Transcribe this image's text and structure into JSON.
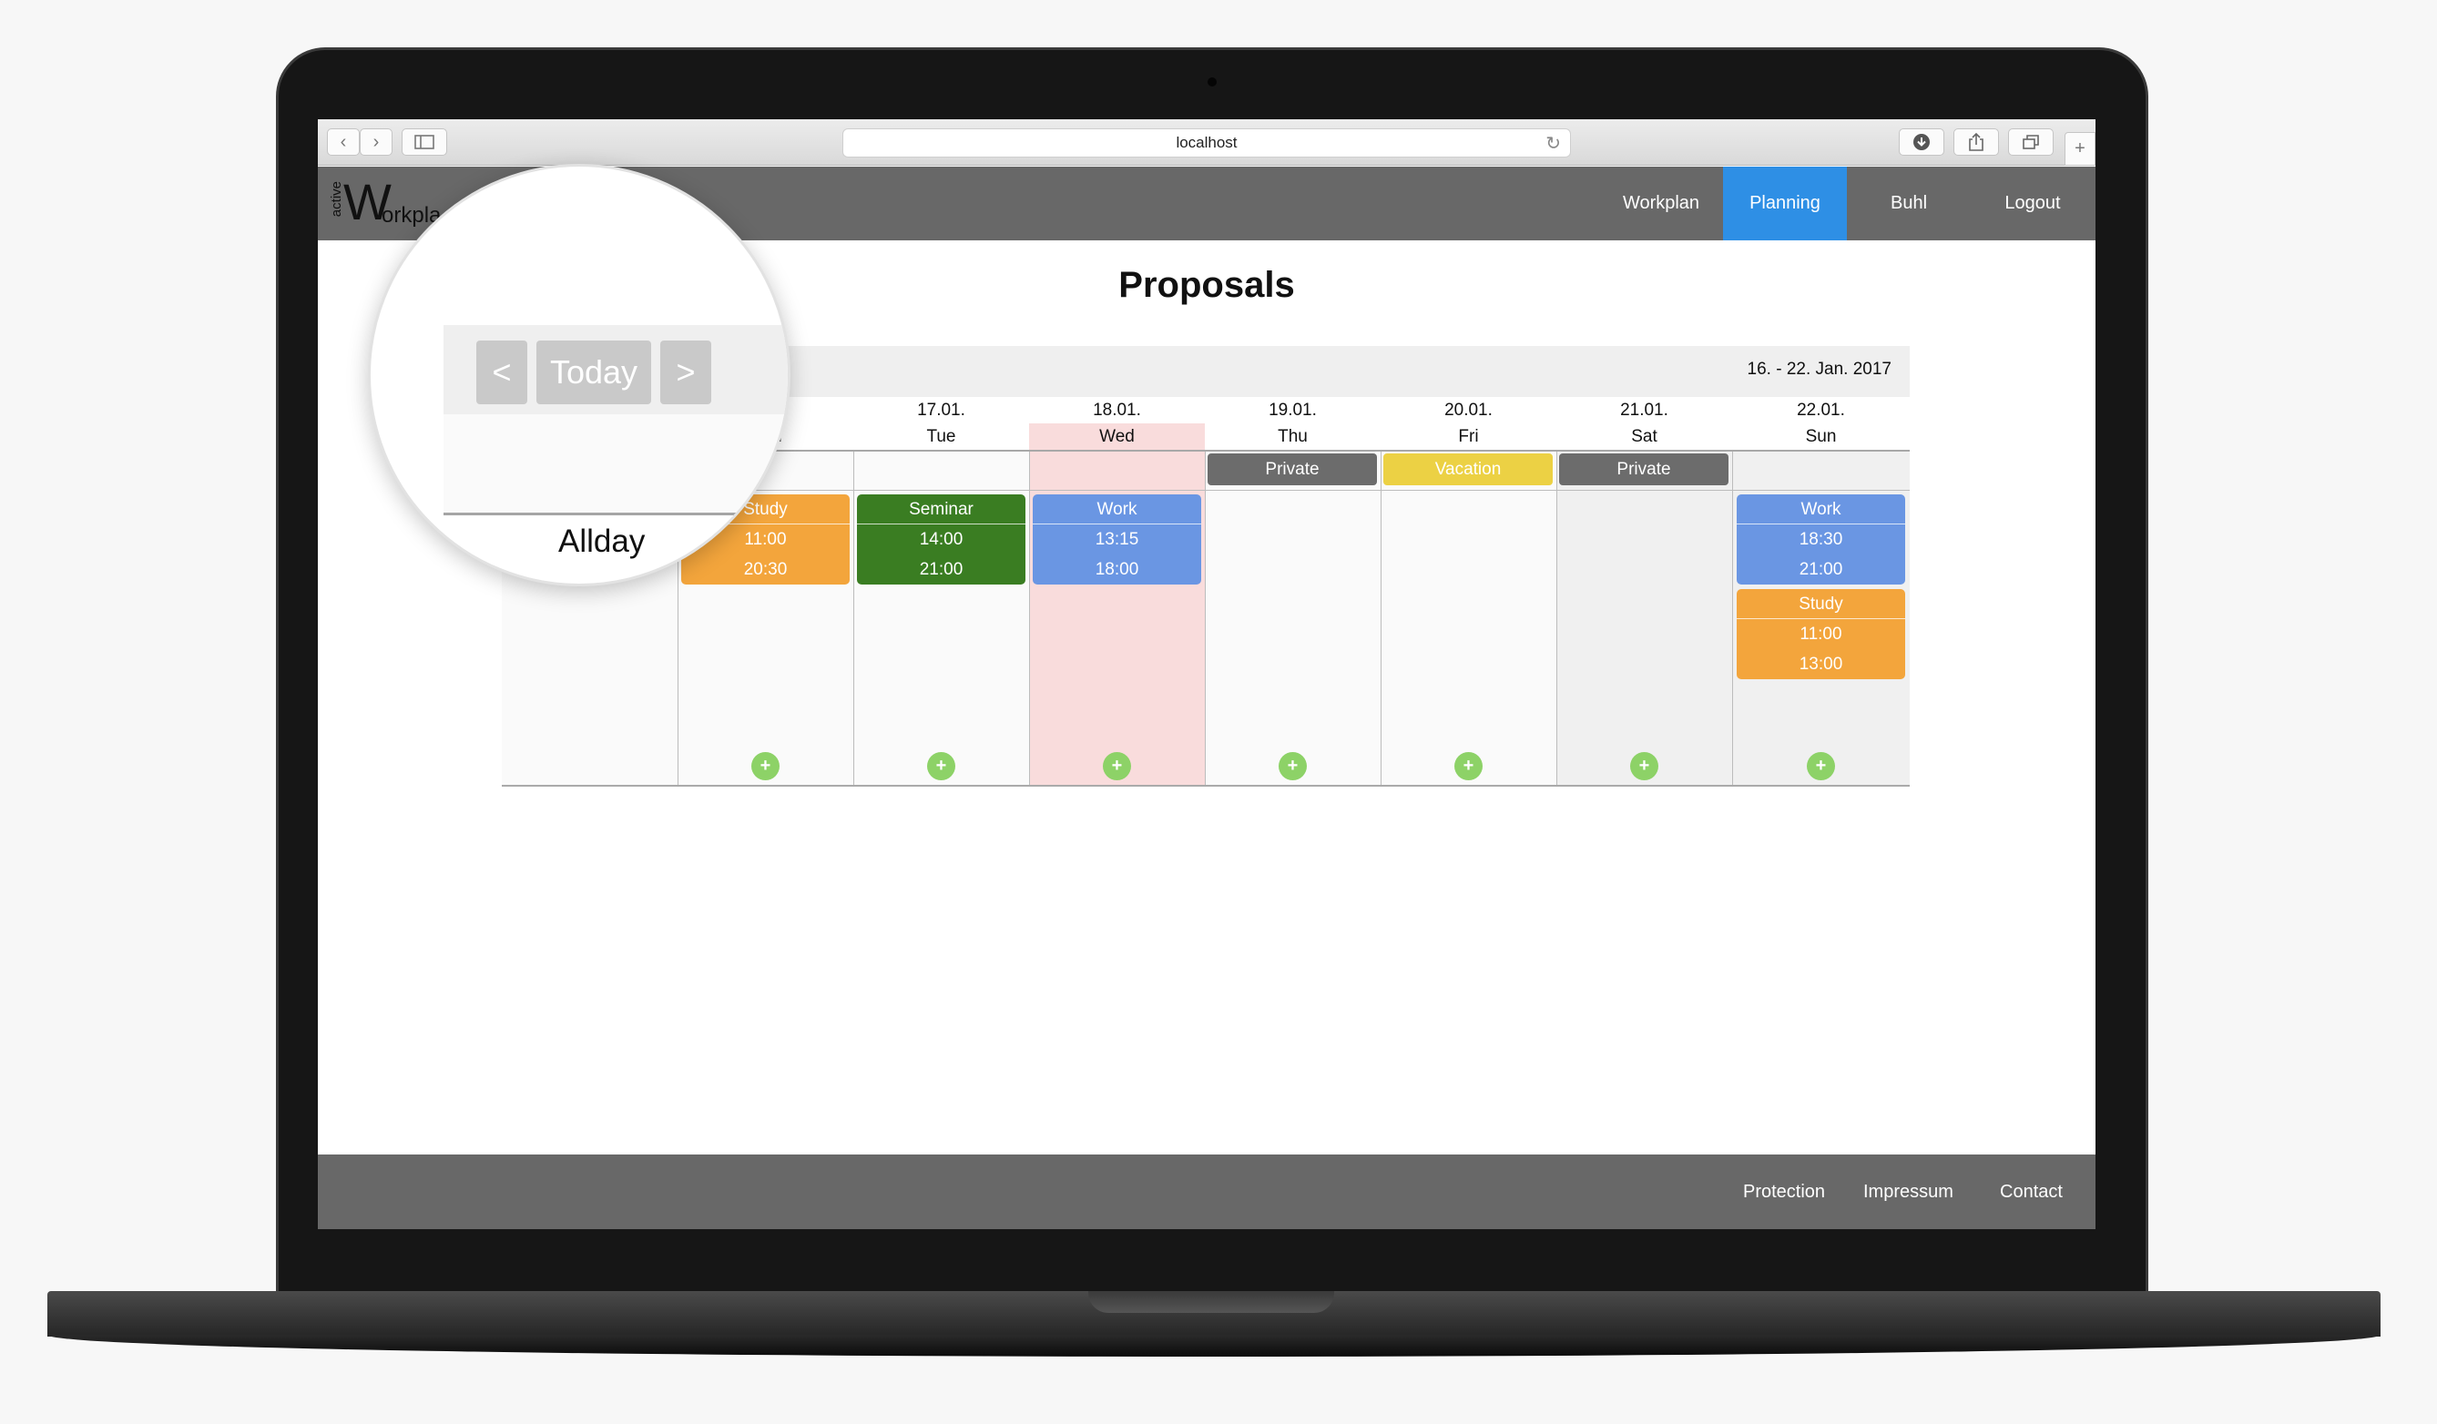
{
  "browser": {
    "url": "localhost",
    "back_icon": "chevron-left-icon",
    "forward_icon": "chevron-right-icon",
    "sidebar_icon": "sidebar-icon",
    "reload_icon": "reload-icon",
    "download_icon": "download-icon",
    "share_icon": "share-icon",
    "tabs_icon": "tabs-icon",
    "new_tab_icon": "plus-icon"
  },
  "app": {
    "logo_small": "active",
    "logo_big": "W",
    "logo_rest": "orkpla"
  },
  "nav": {
    "items": [
      {
        "label": "Workplan",
        "active": false
      },
      {
        "label": "Planning",
        "active": true
      },
      {
        "label": "Buhl",
        "active": false
      },
      {
        "label": "Logout",
        "active": false
      }
    ],
    "active_color": "#2e8fe5"
  },
  "page": {
    "title": "Proposals"
  },
  "calendar": {
    "range": "16. - 22. Jan. 2017",
    "prev_label": "<",
    "today_label": "Today",
    "next_label": ">",
    "allday_label": "Allday",
    "days": [
      {
        "date": ".",
        "name": "n"
      },
      {
        "date": "17.01.",
        "name": "Tue"
      },
      {
        "date": "18.01.",
        "name": "Wed"
      },
      {
        "date": "19.01.",
        "name": "Thu"
      },
      {
        "date": "20.01.",
        "name": "Fri"
      },
      {
        "date": "21.01.",
        "name": "Sat"
      },
      {
        "date": "22.01.",
        "name": "Sun"
      }
    ],
    "allday_tags": [
      {
        "day": "Thu",
        "label": "Private",
        "color": "#6c6c6c"
      },
      {
        "day": "Fri",
        "label": "Vacation",
        "color": "#ecd144"
      },
      {
        "day": "Sat",
        "label": "Private",
        "color": "#6c6c6c"
      }
    ],
    "events": [
      {
        "day": "Mon",
        "title": "Study",
        "start": "11:00",
        "end": "20:30",
        "color": "#f3a53c"
      },
      {
        "day": "Tue",
        "title": "Seminar",
        "start": "14:00",
        "end": "21:00",
        "color": "#3a7d22"
      },
      {
        "day": "Wed",
        "title": "Work",
        "start": "13:15",
        "end": "18:00",
        "color": "#6a96e3"
      },
      {
        "day": "Sun",
        "title": "Work",
        "start": "18:30",
        "end": "21:00",
        "color": "#6a96e3"
      },
      {
        "day": "Sun",
        "title": "Study",
        "start": "11:00",
        "end": "13:00",
        "color": "#f3a53c"
      }
    ],
    "add_label": "+",
    "today_highlight_color": "#f9dcdc",
    "add_button_color": "#8dd267"
  },
  "footer": {
    "links": [
      "Protection",
      "Impressum",
      "Contact"
    ]
  }
}
